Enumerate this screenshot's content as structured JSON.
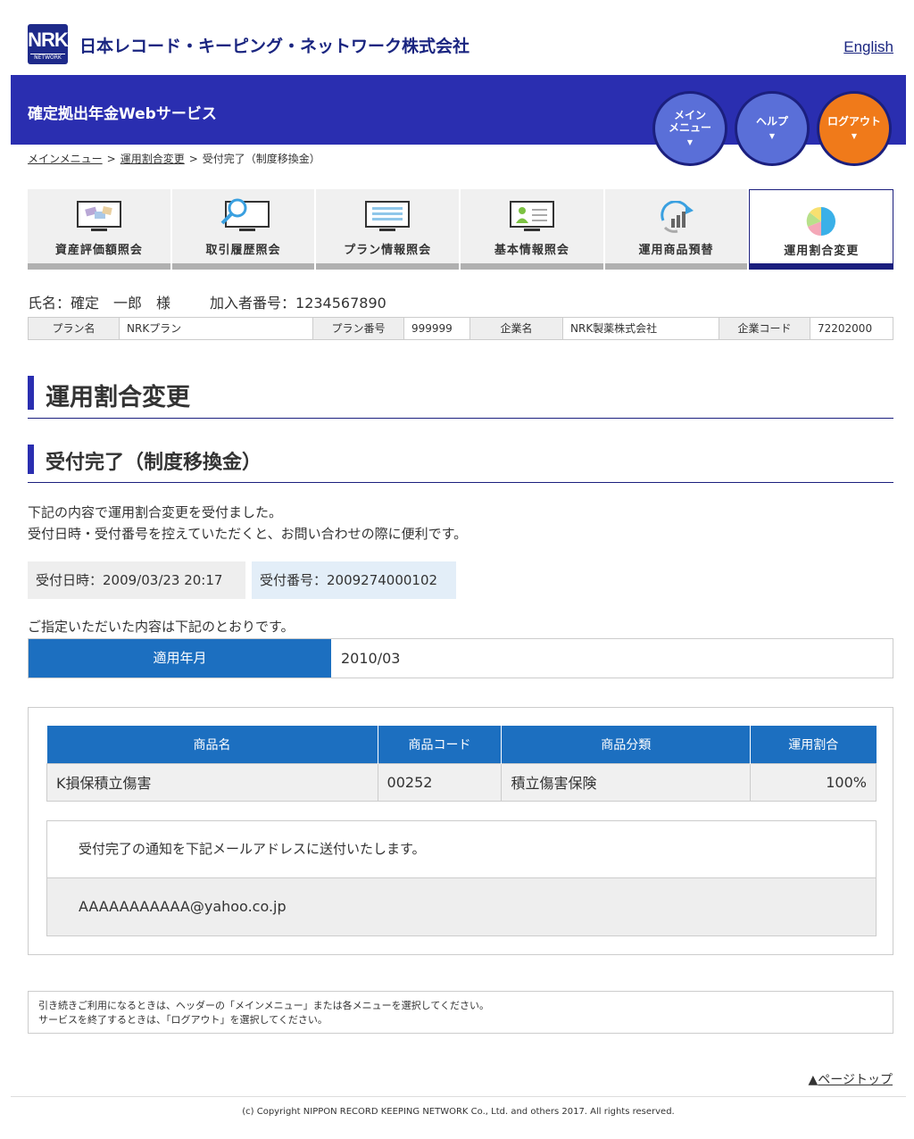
{
  "header": {
    "logo_top": "NRK",
    "logo_bottom": "NETWORK",
    "company": "日本レコード・キーピング・ネットワーク株式会社",
    "english_link": "English",
    "service_title": "確定拠出年金Webサービス",
    "buttons": [
      {
        "line1": "メイン",
        "line2": "メニュー",
        "color": "#5a6fd8"
      },
      {
        "line1": "ヘルプ",
        "line2": "",
        "color": "#5a6fd8"
      },
      {
        "line1": "ログアウト",
        "line2": "",
        "color": "#f07a1a"
      }
    ]
  },
  "breadcrumb": [
    "メインメニュー",
    "運用割合変更",
    "受付完了（制度移換金）"
  ],
  "tabs": [
    {
      "label": "資産評価額照会",
      "icon": "asset-monitor-icon"
    },
    {
      "label": "取引履歴照会",
      "icon": "magnifier-monitor-icon"
    },
    {
      "label": "プラン情報照会",
      "icon": "document-monitor-icon"
    },
    {
      "label": "基本情報照会",
      "icon": "person-monitor-icon"
    },
    {
      "label": "運用商品預替",
      "icon": "refresh-chart-icon"
    },
    {
      "label": "運用割合変更",
      "icon": "pie-chart-icon",
      "active": true
    }
  ],
  "user": {
    "name": "氏名：確定　一郎　様",
    "member": "加入者番号：1234567890"
  },
  "plan": {
    "plan_name_label": "プラン名",
    "plan_name": "NRKプラン",
    "plan_no_label": "プラン番号",
    "plan_no": "999999",
    "company_label": "企業名",
    "company": "NRK製薬株式会社",
    "company_code_label": "企業コード",
    "company_code": "72202000"
  },
  "headings": {
    "h1": "運用割合変更",
    "h2": "受付完了（制度移換金）"
  },
  "message": {
    "line1": "下記の内容で運用割合変更を受付ました。",
    "line2": "受付日時・受付番号を控えていただくと、お問い合わせの際に便利です。"
  },
  "receipt": {
    "datetime": "受付日時：2009/03/23 20:17",
    "number": "受付番号：2009274000102"
  },
  "spec_text": "ご指定いただいた内容は下記のとおりです。",
  "apply": {
    "label": "適用年月",
    "value": "2010/03"
  },
  "table": {
    "headers": [
      "商品名",
      "商品コード",
      "商品分類",
      "運用割合"
    ],
    "rows": [
      [
        "K損保積立傷害",
        "00252",
        "積立傷害保険",
        "100%"
      ]
    ]
  },
  "mail": {
    "notice": "受付完了の通知を下記メールアドレスに送付いたします。",
    "address": "AAAAAAAAAAA@yahoo.co.jp"
  },
  "note": {
    "line1": "引き続きご利用になるときは、ヘッダーの「メインメニュー」または各メニューを選択してください。",
    "line2": "サービスを終了するときは、「ログアウト」を選択してください。"
  },
  "page_top": "ページトップ",
  "footer": "(c) Copyright NIPPON RECORD KEEPING NETWORK Co., Ltd. and others 2017. All rights reserved."
}
